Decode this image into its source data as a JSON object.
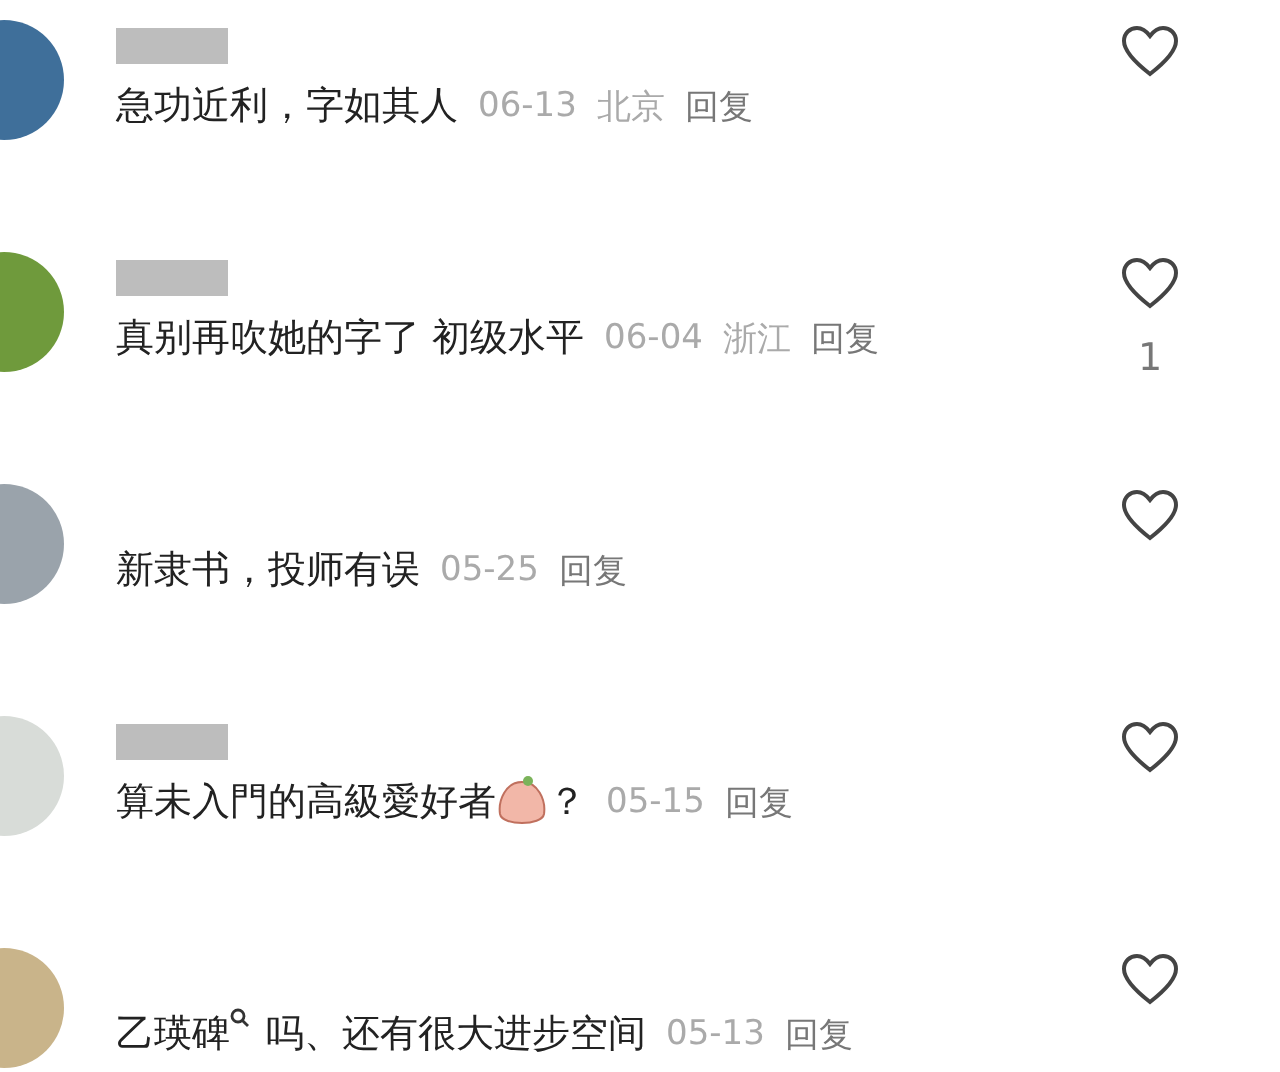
{
  "comments": [
    {
      "avatar": {
        "color": "#3f6f9a"
      },
      "name_hidden": true,
      "parts": [
        {
          "kind": "text",
          "text": "急功近利，字如其人"
        }
      ],
      "date": "06-13",
      "location": "北京",
      "reply": "回复",
      "liked": false
    },
    {
      "avatar": {
        "color": "#6f9a3c"
      },
      "name_hidden": true,
      "parts": [
        {
          "kind": "text",
          "text": "真别再吹她的字了  初级水平"
        }
      ],
      "date": "06-04",
      "location": "浙江",
      "reply": "回复",
      "liked": false,
      "likes": "1"
    },
    {
      "avatar": {
        "color": "#9aa3ab"
      },
      "name_hidden": false,
      "parts": [
        {
          "kind": "text",
          "text": "新隶书，投师有误"
        }
      ],
      "date": "05-25",
      "reply": "回复",
      "liked": false
    },
    {
      "avatar": {
        "color": "#d8dcd8"
      },
      "name_hidden": true,
      "parts": [
        {
          "kind": "text",
          "text": "算未入門的高級愛好者"
        },
        {
          "kind": "emoji"
        },
        {
          "kind": "text",
          "text": "？"
        }
      ],
      "date": "05-15",
      "reply": "回复",
      "liked": false
    },
    {
      "avatar": {
        "color": "#c9b48a"
      },
      "name_hidden": false,
      "parts": [
        {
          "kind": "keyword",
          "text": "乙瑛碑"
        },
        {
          "kind": "text",
          "text": "吗、还有很大进步空间"
        }
      ],
      "date": "05-13",
      "reply": "回复",
      "liked": false
    }
  ]
}
